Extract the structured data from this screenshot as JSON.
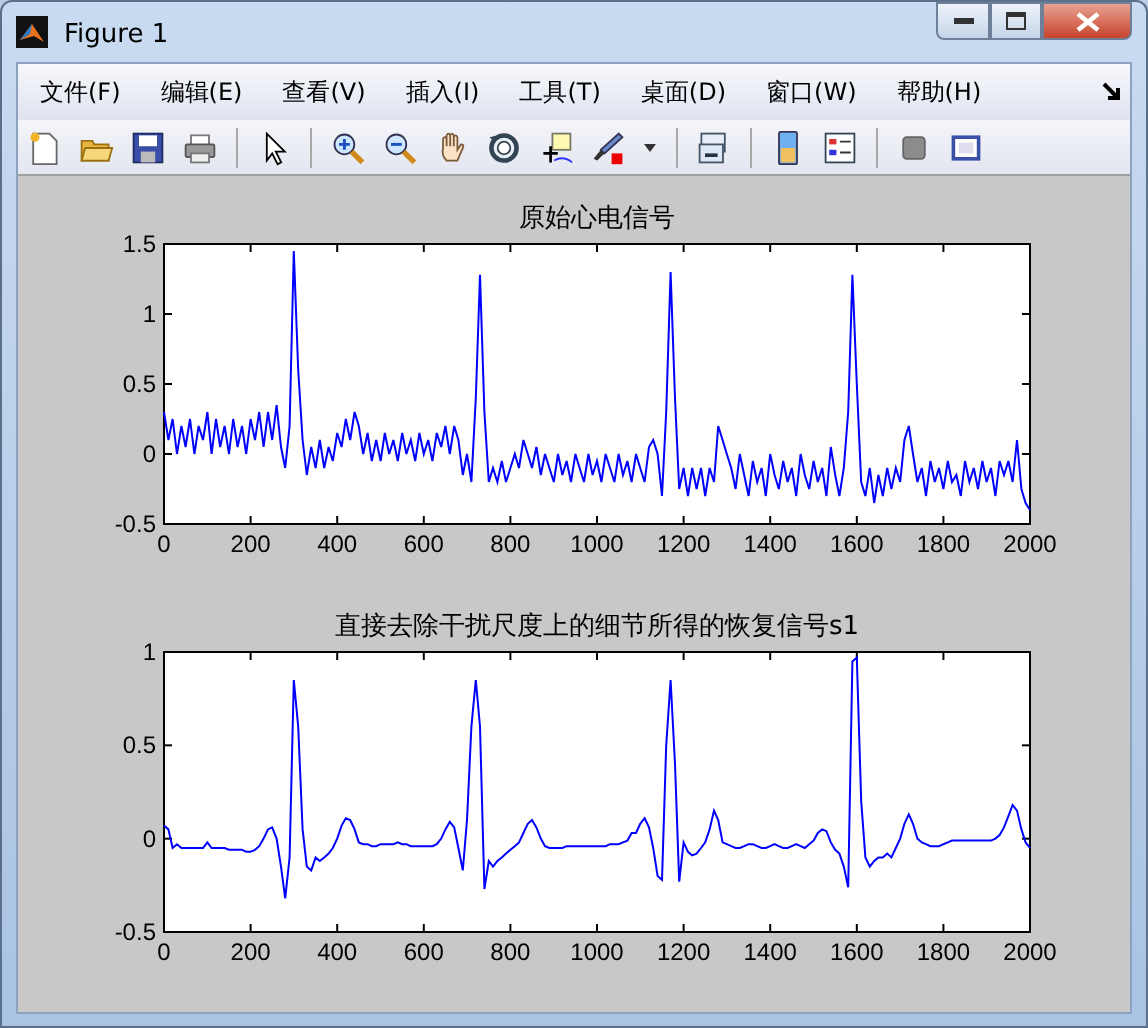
{
  "window": {
    "title": "Figure 1"
  },
  "menu": [
    "文件(F)",
    "编辑(E)",
    "查看(V)",
    "插入(I)",
    "工具(T)",
    "桌面(D)",
    "窗口(W)",
    "帮助(H)"
  ],
  "plots": [
    {
      "chart_data": {
        "type": "line",
        "title": "原始心电信号",
        "xlim": [
          0,
          2000
        ],
        "ylim": [
          -0.5,
          1.5
        ],
        "xticks": [
          0,
          200,
          400,
          600,
          800,
          1000,
          1200,
          1400,
          1600,
          1800,
          2000
        ],
        "yticks": [
          -0.5,
          0,
          0.5,
          1,
          1.5
        ],
        "x": [
          0,
          10,
          20,
          30,
          40,
          50,
          60,
          70,
          80,
          90,
          100,
          110,
          120,
          130,
          140,
          150,
          160,
          170,
          180,
          190,
          200,
          210,
          220,
          230,
          240,
          250,
          260,
          270,
          280,
          290,
          300,
          310,
          320,
          330,
          340,
          350,
          360,
          370,
          380,
          390,
          400,
          410,
          420,
          430,
          440,
          450,
          460,
          470,
          480,
          490,
          500,
          510,
          520,
          530,
          540,
          550,
          560,
          570,
          580,
          590,
          600,
          610,
          620,
          630,
          640,
          650,
          660,
          670,
          680,
          690,
          700,
          710,
          720,
          730,
          740,
          750,
          760,
          770,
          780,
          790,
          800,
          810,
          820,
          830,
          840,
          850,
          860,
          870,
          880,
          890,
          900,
          910,
          920,
          930,
          940,
          950,
          960,
          970,
          980,
          990,
          1000,
          1010,
          1020,
          1030,
          1040,
          1050,
          1060,
          1070,
          1080,
          1090,
          1100,
          1110,
          1120,
          1130,
          1140,
          1150,
          1160,
          1170,
          1180,
          1190,
          1200,
          1210,
          1220,
          1230,
          1240,
          1250,
          1260,
          1270,
          1280,
          1290,
          1300,
          1310,
          1320,
          1330,
          1340,
          1350,
          1360,
          1370,
          1380,
          1390,
          1400,
          1410,
          1420,
          1430,
          1440,
          1450,
          1460,
          1470,
          1480,
          1490,
          1500,
          1510,
          1520,
          1530,
          1540,
          1550,
          1560,
          1570,
          1580,
          1590,
          1600,
          1610,
          1620,
          1630,
          1640,
          1650,
          1660,
          1670,
          1680,
          1690,
          1700,
          1710,
          1720,
          1730,
          1740,
          1750,
          1760,
          1770,
          1780,
          1790,
          1800,
          1810,
          1820,
          1830,
          1840,
          1850,
          1860,
          1870,
          1880,
          1890,
          1900,
          1910,
          1920,
          1930,
          1940,
          1950,
          1960,
          1970,
          1980,
          1990,
          2000
        ],
        "series": [
          {
            "color": "#0000ff",
            "values": [
              0.3,
              0.1,
              0.25,
              0.0,
              0.2,
              0.05,
              0.25,
              0.0,
              0.2,
              0.1,
              0.3,
              0.0,
              0.25,
              0.05,
              0.2,
              0.0,
              0.25,
              0.05,
              0.2,
              0.0,
              0.25,
              0.1,
              0.3,
              0.05,
              0.3,
              0.1,
              0.35,
              0.05,
              -0.1,
              0.2,
              1.45,
              0.6,
              0.1,
              -0.15,
              0.05,
              -0.1,
              0.1,
              -0.1,
              0.05,
              -0.05,
              0.15,
              0.05,
              0.25,
              0.1,
              0.3,
              0.2,
              0.0,
              0.15,
              -0.05,
              0.1,
              -0.05,
              0.15,
              0.0,
              0.1,
              -0.05,
              0.15,
              0.0,
              0.1,
              -0.05,
              0.15,
              0.0,
              0.1,
              -0.05,
              0.15,
              0.05,
              0.2,
              0.0,
              0.2,
              0.1,
              -0.15,
              0.0,
              -0.2,
              0.4,
              1.28,
              0.3,
              -0.2,
              -0.1,
              -0.2,
              -0.05,
              -0.2,
              -0.1,
              0.0,
              -0.1,
              0.1,
              0.0,
              -0.1,
              0.05,
              -0.15,
              0.0,
              -0.1,
              -0.2,
              0.0,
              -0.15,
              -0.05,
              -0.2,
              0.0,
              -0.1,
              -0.2,
              0.0,
              -0.15,
              -0.05,
              -0.2,
              0.0,
              -0.1,
              -0.2,
              0.0,
              -0.15,
              -0.05,
              -0.2,
              0.0,
              -0.1,
              -0.2,
              0.05,
              0.1,
              0.0,
              -0.3,
              0.3,
              1.3,
              0.4,
              -0.25,
              -0.1,
              -0.3,
              -0.1,
              -0.25,
              -0.1,
              -0.3,
              -0.1,
              -0.2,
              0.2,
              0.1,
              0.0,
              -0.1,
              -0.25,
              0.0,
              -0.15,
              -0.3,
              -0.05,
              -0.2,
              -0.1,
              -0.3,
              0.0,
              -0.15,
              -0.25,
              -0.05,
              -0.2,
              -0.1,
              -0.3,
              0.0,
              -0.15,
              -0.25,
              -0.05,
              -0.2,
              -0.1,
              -0.3,
              0.05,
              -0.15,
              -0.3,
              -0.1,
              0.3,
              1.28,
              0.5,
              -0.2,
              -0.3,
              -0.1,
              -0.35,
              -0.15,
              -0.3,
              -0.1,
              -0.25,
              -0.1,
              -0.2,
              0.1,
              0.2,
              0.0,
              -0.2,
              -0.1,
              -0.3,
              -0.05,
              -0.2,
              -0.1,
              -0.25,
              -0.05,
              -0.2,
              -0.15,
              -0.3,
              -0.05,
              -0.2,
              -0.1,
              -0.25,
              -0.05,
              -0.2,
              -0.1,
              -0.3,
              -0.05,
              -0.15,
              -0.05,
              -0.2,
              0.1,
              -0.25,
              -0.35,
              -0.4
            ]
          }
        ]
      }
    },
    {
      "chart_data": {
        "type": "line",
        "title": "直接去除干扰尺度上的细节所得的恢复信号s1",
        "xlim": [
          0,
          2000
        ],
        "ylim": [
          -0.5,
          1
        ],
        "xticks": [
          0,
          200,
          400,
          600,
          800,
          1000,
          1200,
          1400,
          1600,
          1800,
          2000
        ],
        "yticks": [
          -0.5,
          0,
          0.5,
          1
        ],
        "x": [
          0,
          10,
          20,
          30,
          40,
          50,
          60,
          70,
          80,
          90,
          100,
          110,
          120,
          130,
          140,
          150,
          160,
          170,
          180,
          190,
          200,
          210,
          220,
          230,
          240,
          250,
          260,
          270,
          280,
          290,
          300,
          310,
          320,
          330,
          340,
          350,
          360,
          370,
          380,
          390,
          400,
          410,
          420,
          430,
          440,
          450,
          460,
          470,
          480,
          490,
          500,
          510,
          520,
          530,
          540,
          550,
          560,
          570,
          580,
          590,
          600,
          610,
          620,
          630,
          640,
          650,
          660,
          670,
          680,
          690,
          700,
          710,
          720,
          730,
          740,
          750,
          760,
          770,
          780,
          790,
          800,
          810,
          820,
          830,
          840,
          850,
          860,
          870,
          880,
          890,
          900,
          910,
          920,
          930,
          940,
          950,
          960,
          970,
          980,
          990,
          1000,
          1010,
          1020,
          1030,
          1040,
          1050,
          1060,
          1070,
          1080,
          1090,
          1100,
          1110,
          1120,
          1130,
          1140,
          1150,
          1160,
          1170,
          1180,
          1190,
          1200,
          1210,
          1220,
          1230,
          1240,
          1250,
          1260,
          1270,
          1280,
          1290,
          1300,
          1310,
          1320,
          1330,
          1340,
          1350,
          1360,
          1370,
          1380,
          1390,
          1400,
          1410,
          1420,
          1430,
          1440,
          1450,
          1460,
          1470,
          1480,
          1490,
          1500,
          1510,
          1520,
          1530,
          1540,
          1550,
          1560,
          1570,
          1580,
          1590,
          1600,
          1610,
          1620,
          1630,
          1640,
          1650,
          1660,
          1670,
          1680,
          1690,
          1700,
          1710,
          1720,
          1730,
          1740,
          1750,
          1760,
          1770,
          1780,
          1790,
          1800,
          1810,
          1820,
          1830,
          1840,
          1850,
          1860,
          1870,
          1880,
          1890,
          1900,
          1910,
          1920,
          1930,
          1940,
          1950,
          1960,
          1970,
          1980,
          1990,
          2000
        ],
        "series": [
          {
            "color": "#0000ff",
            "values": [
              0.07,
              0.05,
              -0.05,
              -0.03,
              -0.05,
              -0.05,
              -0.05,
              -0.05,
              -0.05,
              -0.05,
              -0.02,
              -0.05,
              -0.05,
              -0.05,
              -0.05,
              -0.06,
              -0.06,
              -0.06,
              -0.06,
              -0.07,
              -0.07,
              -0.06,
              -0.04,
              0.0,
              0.05,
              0.06,
              0.0,
              -0.15,
              -0.32,
              -0.1,
              0.85,
              0.6,
              0.05,
              -0.15,
              -0.17,
              -0.1,
              -0.12,
              -0.1,
              -0.08,
              -0.05,
              0.0,
              0.07,
              0.11,
              0.1,
              0.05,
              -0.02,
              -0.03,
              -0.03,
              -0.04,
              -0.04,
              -0.03,
              -0.03,
              -0.03,
              -0.03,
              -0.02,
              -0.03,
              -0.03,
              -0.04,
              -0.04,
              -0.04,
              -0.04,
              -0.04,
              -0.04,
              -0.03,
              0.0,
              0.05,
              0.09,
              0.06,
              -0.05,
              -0.17,
              0.1,
              0.6,
              0.85,
              0.6,
              -0.27,
              -0.12,
              -0.15,
              -0.12,
              -0.1,
              -0.08,
              -0.06,
              -0.04,
              -0.02,
              0.03,
              0.08,
              0.1,
              0.06,
              0.0,
              -0.04,
              -0.05,
              -0.05,
              -0.05,
              -0.05,
              -0.04,
              -0.04,
              -0.04,
              -0.04,
              -0.04,
              -0.04,
              -0.04,
              -0.04,
              -0.04,
              -0.04,
              -0.03,
              -0.03,
              -0.03,
              -0.02,
              -0.01,
              0.03,
              0.03,
              0.08,
              0.11,
              0.06,
              -0.05,
              -0.2,
              -0.22,
              0.5,
              0.85,
              0.4,
              -0.23,
              -0.02,
              -0.07,
              -0.09,
              -0.08,
              -0.05,
              -0.02,
              0.05,
              0.15,
              0.1,
              -0.02,
              -0.03,
              -0.04,
              -0.05,
              -0.05,
              -0.04,
              -0.03,
              -0.03,
              -0.04,
              -0.05,
              -0.05,
              -0.04,
              -0.03,
              -0.04,
              -0.05,
              -0.05,
              -0.04,
              -0.03,
              -0.04,
              -0.05,
              -0.03,
              -0.01,
              0.03,
              0.05,
              0.04,
              -0.02,
              -0.06,
              -0.08,
              -0.15,
              -0.26,
              0.95,
              0.97,
              0.2,
              -0.1,
              -0.15,
              -0.12,
              -0.1,
              -0.1,
              -0.08,
              -0.1,
              -0.05,
              0.0,
              0.08,
              0.13,
              0.08,
              0.0,
              -0.02,
              -0.03,
              -0.04,
              -0.04,
              -0.04,
              -0.03,
              -0.02,
              -0.01,
              -0.01,
              -0.01,
              -0.01,
              -0.01,
              -0.01,
              -0.01,
              -0.01,
              -0.01,
              -0.01,
              0.0,
              0.02,
              0.06,
              0.12,
              0.18,
              0.15,
              0.05,
              -0.02,
              -0.05
            ]
          }
        ]
      }
    }
  ]
}
